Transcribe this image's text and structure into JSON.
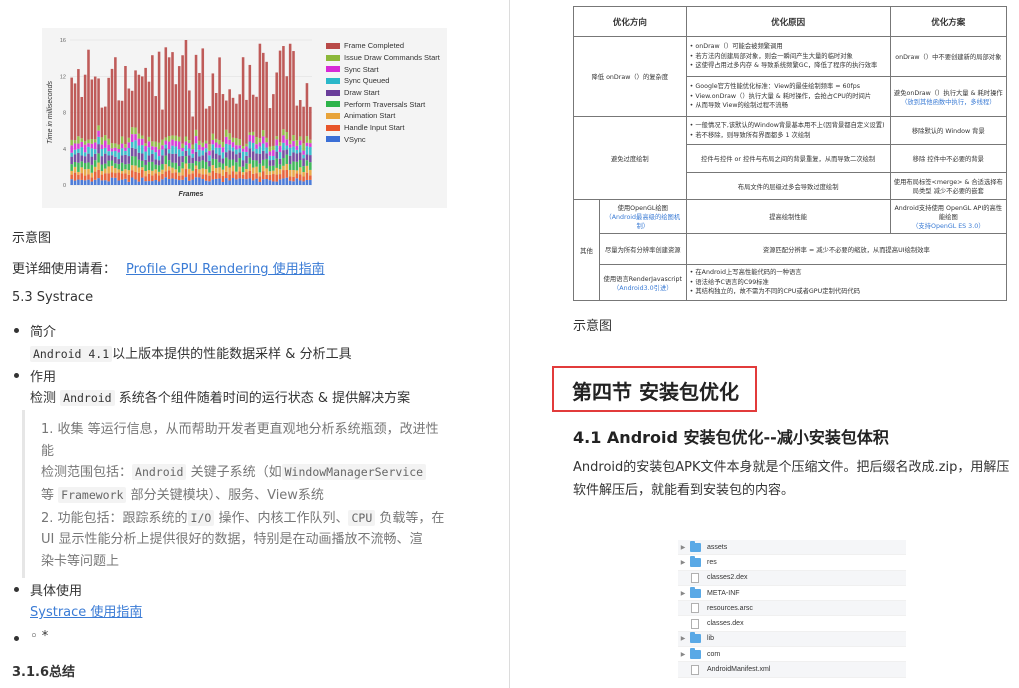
{
  "left": {
    "chart": {
      "y_axis_label": "Time in milliseconds",
      "x_axis_label": "Frames",
      "y_ticks": [
        "16",
        "12",
        "8",
        "4",
        "0"
      ],
      "legend": [
        {
          "label": "Frame Completed",
          "color": "#b94a48"
        },
        {
          "label": "Issue Draw Commands Start",
          "color": "#8cb83a"
        },
        {
          "label": "Sync Start",
          "color": "#d62ad6"
        },
        {
          "label": "Sync Queued",
          "color": "#2ab7c9"
        },
        {
          "label": "Draw Start",
          "color": "#6a3d9a"
        },
        {
          "label": "Perform Traversals Start",
          "color": "#2db34a"
        },
        {
          "label": "Animation Start",
          "color": "#e8a33a"
        },
        {
          "label": "Handle Input Start",
          "color": "#e8552a"
        },
        {
          "label": "VSync",
          "color": "#3b6fd6"
        }
      ]
    },
    "caption": "示意图",
    "more_prefix": "更详细使用请看：",
    "more_link": "Profile GPU Rendering 使用指南",
    "section": "5.3 Systrace",
    "intro_title": "简介",
    "intro_code": "Android 4.1",
    "intro_text": "以上版本提供的性能数据采样 & 分析工具",
    "role_title": "作用",
    "role_pre": "检测 ",
    "role_code": "Android",
    "role_text": " 系统各个组件随着时间的运行状态 & 提供解决方案",
    "q1_line1": "1. 收集 等运行信息，从而帮助开发者更直观地分析系统瓶颈，改进性",
    "q1_line2": "能",
    "q1_l3_pre": "检测范围包括：",
    "q1_l3_code1": "Android",
    "q1_l3_mid": " 关键子系统（如",
    "q1_l3_code2": "WindowManagerService",
    "q1_l4_pre": "等 ",
    "q1_l4_code": "Framework",
    "q1_l4_text": " 部分关键模块）、服务、View系统",
    "q2_l1_pre": "2. 功能包括：跟踪系统的",
    "q2_l1_code1": "I/O",
    "q2_l1_mid": " 操作、内核工作队列、",
    "q2_l1_code2": "CPU",
    "q2_l1_end": " 负载等，在",
    "q2_line2": "UI 显示性能分析上提供很好的数据，特别是在动画播放不流畅、渲",
    "q2_line3": "染卡等问题上",
    "usage_title": "具体使用",
    "usage_link": "Systrace 使用指南",
    "empty_bullet": "◦ *",
    "summary_heading": "3.1.6总结"
  },
  "right": {
    "table": {
      "headers": [
        "优化方向",
        "优化原因",
        "优化方案"
      ],
      "r1_dir": "降低 onDraw（）的复杂度",
      "r1a_reason": [
        "• onDraw（）可能会被频繁调用",
        "• 若方法内创建局部对象，则会一瞬间产生大量的临时对象",
        "• 这使得占用过多内存 & 导致系统频繁GC，降低了程序的执行效率"
      ],
      "r1a_solution": "onDraw（）中不要创建新的局部对象",
      "r1b_reason": [
        "• Google官方性能优化标准：View的最佳绘制频率 = 60fps",
        "• View.onDraw（）执行大量 & 耗时操作，会抢占CPU的时间片",
        "• 从而导致 View的绘制过程不流畅"
      ],
      "r1b_solution": "避免onDraw（）执行大量 & 耗时操作",
      "r1b_solution_note": "（放到其他函数中执行，多线程）",
      "r2_dir": "避免过度绘制",
      "r2a_reason": [
        "• 一般情况下,该默认的Window背景基本用不上(因背景都自定义设置)",
        "• 若不移除，则导致所有界面都多 1 次绘制"
      ],
      "r2a_solution": "移除默认的 Window 背景",
      "r2b_reason": "控件与控件 or 控件与布局之间的背景重复，从而导致二次绘制",
      "r2b_solution": "移除 控件中不必要的背景",
      "r2c_reason": "布局文件的层级过多会导致过度绘制",
      "r2c_solution": "使用布局标签<merge> & 合适选择布局类型 减少不必要的嵌套",
      "other_label": "其他",
      "r3a_dir": "使用OpenGL绘图",
      "r3a_dir_note": "（Android最高级的绘图机制）",
      "r3a_reason": "提高绘制性能",
      "r3a_solution": "Android支持使用 OpenGL API的高性能绘图",
      "r3a_solution_note": "（支持OpenGL ES 3.0）",
      "r3b_dir": "尽量为所有分辨率创建资源",
      "r3b_merged": "资源匹配分辨率 = 减少不必要的缩放，从而提高UI绘制效率",
      "r3c_dir": "使用语言RenderJavascript",
      "r3c_dir_note": "（Android3.0引进）",
      "r3c_merged": [
        "• 在Android上写高性能代码的一种语言",
        "• 语法给予C语言的C99标准",
        "• 其结构独立的，故不需为不同的CPU或者GPU定制代码代码"
      ]
    },
    "caption": "示意图",
    "h4": "第四节 安装包优化",
    "h41": "4.1 Android 安装包优化--减小安装包体积",
    "para": "Android的安装包APK文件本身就是个压缩文件。把后缀名改成.zip，用解压软件解压后，就能看到安装包的内容。",
    "files": [
      {
        "name": "assets",
        "type": "folder"
      },
      {
        "name": "res",
        "type": "folder"
      },
      {
        "name": "classes2.dex",
        "type": "file"
      },
      {
        "name": "META-INF",
        "type": "folder"
      },
      {
        "name": "resources.arsc",
        "type": "file"
      },
      {
        "name": "classes.dex",
        "type": "file"
      },
      {
        "name": "lib",
        "type": "folder"
      },
      {
        "name": "com",
        "type": "folder"
      },
      {
        "name": "AndroidManifest.xml",
        "type": "file"
      }
    ]
  }
}
